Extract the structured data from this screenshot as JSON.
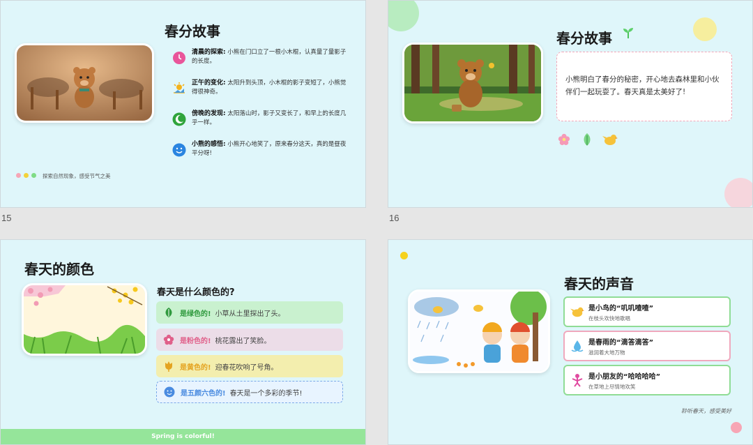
{
  "slides": [
    {
      "number": "15",
      "title": "春分故事",
      "cards": [
        {
          "heading": "清晨的探索:",
          "text": "小熊在门口立了一根小木棍，认真量了量影子的长度。",
          "color": "#ecdde8",
          "icon": "clock-icon"
        },
        {
          "heading": "正午的变化:",
          "text": "太阳升到头顶，小木棍的影子变短了，小熊觉得很神奇。",
          "color": "#f3eeae",
          "icon": "sun-icon"
        },
        {
          "heading": "傍晚的发现:",
          "text": "太阳落山时，影子又变长了，和早上的长度几乎一样。",
          "color": "#d3f3d6",
          "icon": "moon-icon"
        },
        {
          "heading": "小熊的感悟:",
          "text": "小熊开心地笑了，原来春分这天，真的是昼夜平分呀!",
          "color": "#cce9fb",
          "icon": "smile-icon"
        }
      ],
      "footer": "探索自然现象，感受节气之美"
    },
    {
      "number": "16",
      "title": "春分故事",
      "story": "小熊明白了春分的秘密，开心地去森林里和小伙伴们一起玩耍了。春天真是太美好了!"
    },
    {
      "title": "春天的颜色",
      "subtitle": "春天是什么颜色的?",
      "items": [
        {
          "label": "是绿色的!",
          "text": "小草从土里探出了头。",
          "bg": "#c9f1cf",
          "accent": "#3aa24a",
          "icon": "leaf-icon"
        },
        {
          "label": "是粉色的!",
          "text": "桃花露出了笑脸。",
          "bg": "#ecdde8",
          "accent": "#e0608a",
          "icon": "flower-icon"
        },
        {
          "label": "是黄色的!",
          "text": "迎春花吹响了号角。",
          "bg": "#f3eeae",
          "accent": "#e4a320",
          "icon": "tulip-icon"
        },
        {
          "label": "是五颜六色的!",
          "text": "春天是一个多彩的季节!",
          "bg": "#e8f4ff",
          "accent": "#4a8be0",
          "icon": "smile-icon"
        }
      ],
      "banner": "Spring is colorful!"
    },
    {
      "title": "春天的声音",
      "items": [
        {
          "title": "是小鸟的“叽叽喳喳”",
          "desc": "在枝头欢快地歌唱",
          "border": "#8fdc95",
          "icon": "bird-icon"
        },
        {
          "title": "是春雨的“滴答滴答”",
          "desc": "滋润着大地万物",
          "border": "#f0a8bd",
          "icon": "rain-icon"
        },
        {
          "title": "是小朋友的“哈哈哈哈”",
          "desc": "在草地上尽情地欢笑",
          "border": "#8fdc95",
          "icon": "child-icon"
        }
      ],
      "footer": "聆听春天，感受美好"
    }
  ],
  "colors": {
    "slide_bg": "#dff6fa",
    "dot_pink": "#f6a6b6",
    "dot_yellow": "#f3d23a",
    "dot_green": "#7fdc86"
  }
}
